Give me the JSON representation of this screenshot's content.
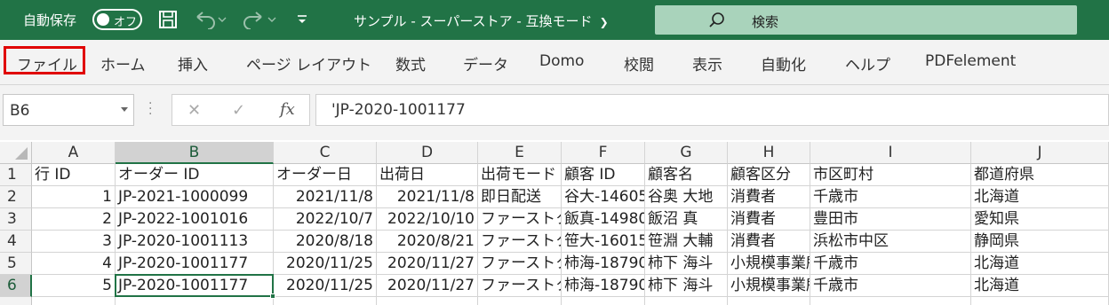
{
  "titlebar": {
    "autosave_label": "自動保存",
    "autosave_state": "オフ",
    "doc_title": "サンプル - スーパーストア - 互換モード",
    "search_label": "検索"
  },
  "ribbon": {
    "tabs": [
      "ファイル",
      "ホーム",
      "挿入",
      "ページ レイアウト",
      "数式",
      "データ",
      "Domo",
      "校閲",
      "表示",
      "自動化",
      "ヘルプ",
      "PDFelement"
    ]
  },
  "formula_bar": {
    "name_box": "B6",
    "formula": "'JP-2020-1001177"
  },
  "grid": {
    "column_headers": [
      "A",
      "B",
      "C",
      "D",
      "E",
      "F",
      "G",
      "H",
      "I",
      "J"
    ],
    "selected_column": "B",
    "selected_row": "6",
    "rows": [
      {
        "row": "1",
        "cells": [
          "行 ID",
          "オーダー ID",
          "オーダー日",
          "出荷日",
          "出荷モード",
          "顧客 ID",
          "顧客名",
          "顧客区分",
          "市区町村",
          "都道府県"
        ]
      },
      {
        "row": "2",
        "cells": [
          "1",
          "JP-2021-1000099",
          "2021/11/8",
          "2021/11/8",
          "即日配送",
          "谷大-14605",
          "谷奥 大地",
          "消費者",
          "千歳市",
          "北海道"
        ]
      },
      {
        "row": "3",
        "cells": [
          "2",
          "JP-2022-1001016",
          "2022/10/7",
          "2022/10/10",
          "ファーストクラス",
          "飯真-14980",
          "飯沼 真",
          "消費者",
          "豊田市",
          "愛知県"
        ]
      },
      {
        "row": "4",
        "cells": [
          "3",
          "JP-2020-1001113",
          "2020/8/18",
          "2020/8/21",
          "ファーストクラス",
          "笹大-16015",
          "笹淵 大輔",
          "消費者",
          "浜松市中区",
          "静岡県"
        ]
      },
      {
        "row": "5",
        "cells": [
          "4",
          "JP-2020-1001177",
          "2020/11/25",
          "2020/11/27",
          "ファーストクラス",
          "柿海-18790",
          "柿下 海斗",
          "小規模事業所",
          "千歳市",
          "北海道"
        ]
      },
      {
        "row": "6",
        "cells": [
          "5",
          "JP-2020-1001177",
          "2020/11/25",
          "2020/11/27",
          "ファーストクラス",
          "柿海-18790",
          "柿下 海斗",
          "小規模事業所",
          "千歳市",
          "北海道"
        ]
      }
    ]
  }
}
